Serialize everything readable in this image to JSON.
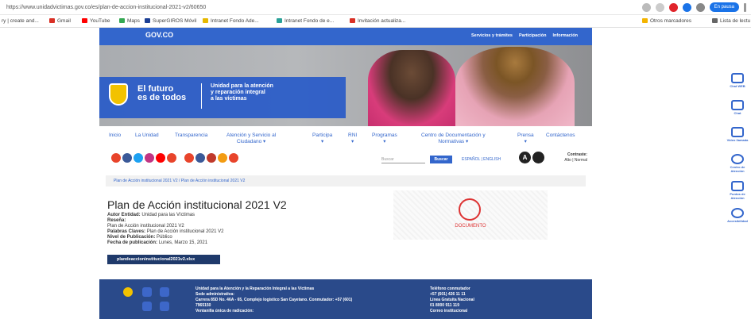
{
  "browser": {
    "url": "https://www.unidadvictimas.gov.co/es/plan-de-accion-institucional-2021-v2/60650",
    "pause_label": "En pausa",
    "bookmarks": [
      "ry | create and...",
      "Gmail",
      "YouTube",
      "Maps",
      "SuperGIROS Móvil",
      "Intranet Fondo Ade...",
      "Intranet Fondo de e...",
      "Invitación actualiza...",
      "Otros marcadores",
      "Lista de lectu"
    ],
    "accent": "#1a73e8"
  },
  "gov": {
    "logo": "GOV.CO",
    "nav": [
      "Servicios y trámites",
      "Participación",
      "Información"
    ]
  },
  "banner": {
    "slogan": "El futuro\nes de todos",
    "unit_name": "Unidad para la atención\ny reparación integral\na las víctimas"
  },
  "mainnav": [
    "Inicio",
    "La Unidad",
    "Transparencia",
    "Atención y Servicio al\nCiudadano ▾",
    "Participa\n▾",
    "RNI\n▾",
    "Programas\n▾",
    "Centro de Documentación y\nNormativas ▾",
    "Prensa\n▾",
    "Contáctenos"
  ],
  "toolbar": {
    "search_placeholder": "Buscar",
    "search_button": "Buscar",
    "languages": "ESPAÑOL | ENGLISH",
    "a_icon": "A",
    "contrast_label": "Contraste:",
    "contrast_options": "Alto | Normal"
  },
  "breadcrumb": "Plan de Acción institucional 2021 V2  /  Plan de Acción institucional 2021 V2",
  "content": {
    "title": "Plan de Acción institucional 2021 V2",
    "author_label": "Autor Entidad:",
    "author": "Unidad para las Víctimas",
    "summary_label": "Reseña:",
    "summary": "Plan de Acción institucional 2021 V2",
    "keywords_label": "Palabras Claves:",
    "keywords": "Plan de Acción institucional 2021 V2",
    "level_label": "Nivel de Publicación:",
    "level": "Público",
    "date_label": "Fecha de publicación:",
    "date": "Lunes, Marzo 15, 2021",
    "file_button": "plandeaccioninstitucional2021v2.xlsx",
    "doc_label": "DOCUMENTO"
  },
  "footer": {
    "col1": "Unidad para la Atención y la Reparación Integral a las Víctimas\nSede administrativa:\nCarrera 85D No. 46A - 65, Complejo logístico San Cayetano. Conmutador: +57 (601)\n7965150\nVentanilla única de radicación:",
    "col2": "Teléfono conmutador\n+57 (601) 426 11 11\nLínea Gratuita Nacional\n01 8000 911 119\nCorreo institucional"
  },
  "sidebar": [
    "Chat WEB",
    "Chat",
    "Video llamada",
    "Centro de Atención",
    "Puntos de Atención",
    "Accesibilidad"
  ]
}
